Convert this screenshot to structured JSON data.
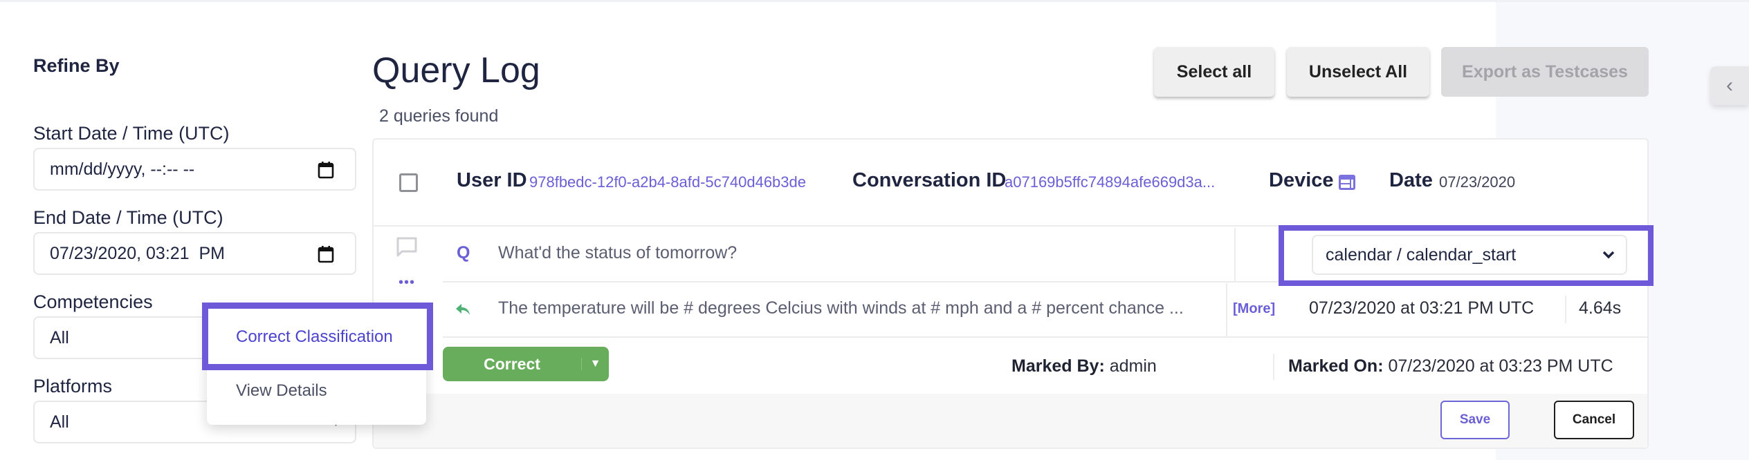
{
  "sidebar": {
    "heading": "Refine By",
    "start_label": "Start Date / Time (UTC)",
    "start_value": "mm/dd/yyyy, --:-- --",
    "end_label": "End Date / Time (UTC)",
    "end_value": "07/23/2020, 03:21  PM",
    "competencies_label": "Competencies",
    "competencies_value": "All",
    "platforms_label": "Platforms",
    "platforms_value": "All"
  },
  "header": {
    "title": "Query Log",
    "count": "2 queries found",
    "select_all": "Select all",
    "unselect_all": "Unselect All",
    "export": "Export as Testcases"
  },
  "record": {
    "user_id_label": "User ID",
    "user_id": "978fbedc-12f0-a2b4-8afd-5c740d46b3de",
    "conversation_id_label": "Conversation ID",
    "conversation_id": "a07169b5ffc74894afe669d3a...",
    "device_label": "Device",
    "date_label": "Date",
    "date": "07/23/2020",
    "query_marker": "Q",
    "query": "What'd the status of tomorrow?",
    "intent": "calendar / calendar_start",
    "response": "The temperature will be # degrees Celcius with winds at # mph and a # percent chance ...",
    "more_link": "[More]",
    "response_time": "07/23/2020 at 03:21 PM UTC",
    "duration": "4.64s",
    "status": "Correct",
    "marked_by_label": "Marked By:",
    "marked_by": "admin",
    "marked_on_label": "Marked On:",
    "marked_on": "07/23/2020 at 03:23 PM UTC",
    "save": "Save",
    "cancel": "Cancel"
  },
  "context_menu": {
    "items": [
      {
        "label": "Correct Classification",
        "highlighted": true
      },
      {
        "label": "View Details",
        "highlighted": false
      }
    ]
  },
  "colors": {
    "accent": "#6e5ad8",
    "link": "#6a5fd6",
    "success": "#67ad5b",
    "text": "#1f2540"
  }
}
